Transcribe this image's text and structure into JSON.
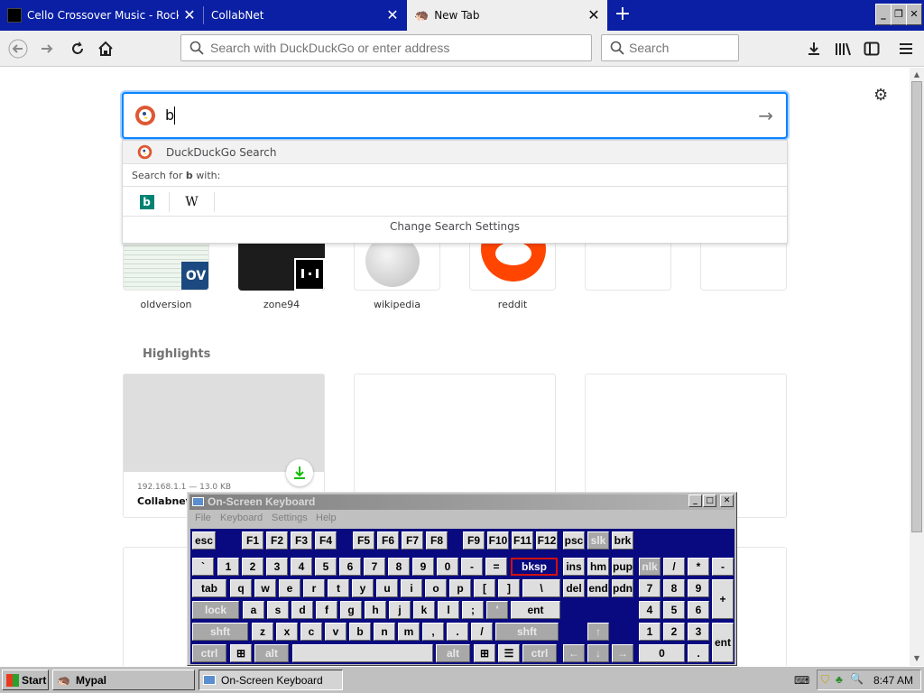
{
  "tabs": [
    {
      "title": "Cello Crossover Music - Rock and",
      "active": false
    },
    {
      "title": "CollabNet",
      "active": false
    },
    {
      "title": "New Tab",
      "active": true
    }
  ],
  "window_buttons": {
    "minimize": "_",
    "restore": "❐",
    "close": "✕"
  },
  "navbar": {
    "url_placeholder": "Search with DuckDuckGo or enter address",
    "search_placeholder": "Search"
  },
  "newtab": {
    "search_value": "b",
    "dropdown": {
      "engine_item": "DuckDuckGo Search",
      "search_for_prefix": "Search for ",
      "search_term": "b",
      "search_for_suffix": " with:",
      "engines": [
        "bing-icon",
        "wikipedia-icon"
      ],
      "change_settings": "Change Search Settings"
    },
    "top_sites": [
      {
        "label": "oldversion"
      },
      {
        "label": "zone94"
      },
      {
        "label": "wikipedia"
      },
      {
        "label": "reddit"
      },
      {
        "label": ""
      },
      {
        "label": ""
      }
    ],
    "highlights": {
      "title": "Highlights",
      "card": {
        "meta": "192.168.1.1 — 13.0 KB",
        "title": "Collabnet"
      }
    }
  },
  "osk": {
    "title": "On-Screen Keyboard",
    "menu": [
      "File",
      "Keyboard",
      "Settings",
      "Help"
    ],
    "fn_row": [
      "esc",
      "F1",
      "F2",
      "F3",
      "F4",
      "F5",
      "F6",
      "F7",
      "F8",
      "F9",
      "F10",
      "F11",
      "F12",
      "psc",
      "slk",
      "brk"
    ],
    "row1": [
      "`",
      "1",
      "2",
      "3",
      "4",
      "5",
      "6",
      "7",
      "8",
      "9",
      "0",
      "-",
      "=",
      "bksp",
      "ins",
      "hm",
      "pup",
      "nlk",
      "/",
      "*",
      "-"
    ],
    "row2": [
      "tab",
      "q",
      "w",
      "e",
      "r",
      "t",
      "y",
      "u",
      "i",
      "o",
      "p",
      "[",
      "]",
      "\\",
      "del",
      "end",
      "pdn",
      "7",
      "8",
      "9",
      "+"
    ],
    "row3": [
      "lock",
      "a",
      "s",
      "d",
      "f",
      "g",
      "h",
      "j",
      "k",
      "l",
      ";",
      "'",
      "ent",
      "4",
      "5",
      "6"
    ],
    "row4": [
      "shft",
      "z",
      "x",
      "c",
      "v",
      "b",
      "n",
      "m",
      ",",
      ".",
      "/",
      "shft",
      "↑",
      "1",
      "2",
      "3",
      "ent"
    ],
    "row5": [
      "ctrl",
      "⊞",
      "alt",
      "",
      "alt",
      "⊞",
      "☰",
      "ctrl",
      "←",
      "↓",
      "→",
      "0",
      "."
    ]
  },
  "taskbar": {
    "start": "Start",
    "items": [
      "Mypal",
      "On-Screen Keyboard"
    ],
    "clock": "8:47 AM"
  },
  "colors": {
    "accent": "#0a84ff",
    "tabbar": "#0a1fa3",
    "osk_bg": "#0a0a80",
    "reddit": "#ff4500",
    "download": "#12bc00"
  }
}
